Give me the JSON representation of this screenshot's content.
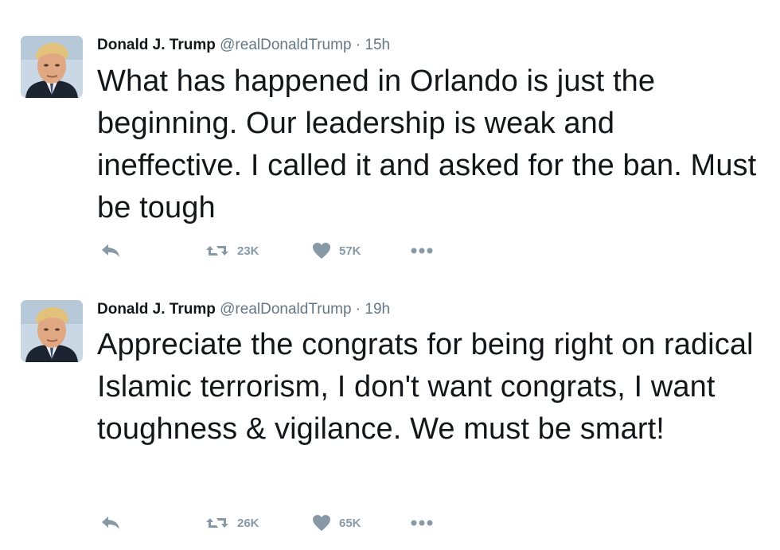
{
  "tweets": [
    {
      "author_name": "Donald J. Trump",
      "handle": "@realDonaldTrump",
      "time": "15h",
      "text": "What has happened in Orlando is just the beginning. Our leadership is weak and ineffective. I called it and asked for the ban. Must be tough",
      "retweets": "23K",
      "likes": "57K"
    },
    {
      "author_name": "Donald J. Trump",
      "handle": "@realDonaldTrump",
      "time": "19h",
      "text": "Appreciate the congrats for being right on radical Islamic terrorism, I don't want congrats, I want toughness & vigilance. We must be smart!",
      "retweets": "26K",
      "likes": "65K"
    }
  ],
  "separator": "·",
  "icons": {
    "reply": "reply-icon",
    "retweet": "retweet-icon",
    "like": "heart-icon",
    "more": "more-dots-icon"
  },
  "colors": {
    "text": "#14171a",
    "secondary": "#657786",
    "action": "#8899a6"
  }
}
